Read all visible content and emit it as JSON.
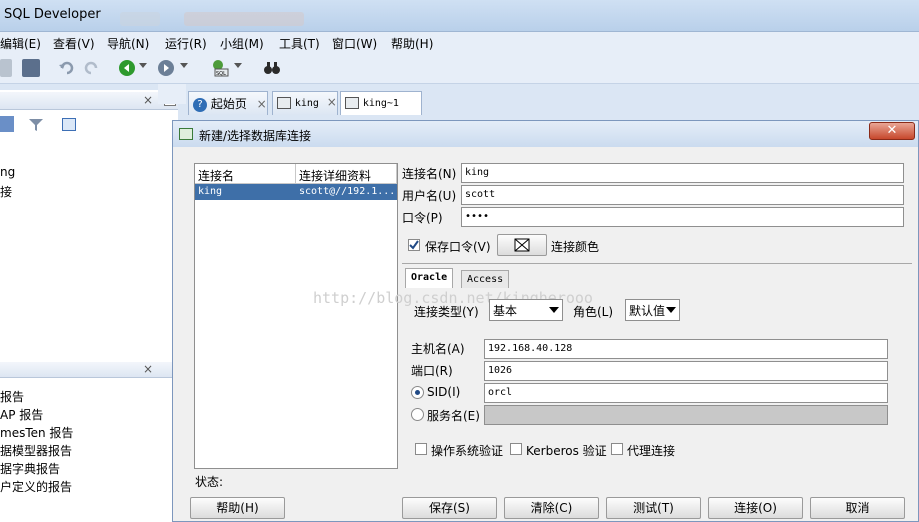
{
  "app": {
    "title": "SQL Developer"
  },
  "menu": [
    "编辑(E)",
    "查看(V)",
    "导航(N)",
    "运行(R)",
    "小组(M)",
    "工具(T)",
    "窗口(W)",
    "帮助(H)"
  ],
  "left_panel": {
    "partial_items_top": [
      "ng",
      "接"
    ],
    "reports": [
      "报告",
      "AP 报告",
      "mesTen 报告",
      "据模型器报告",
      "据字典报告",
      "户定义的报告"
    ]
  },
  "tabs": [
    {
      "label": "起始页"
    },
    {
      "label": "king"
    },
    {
      "label": "king~1"
    }
  ],
  "dialog": {
    "title": "新建/选择数据库连接",
    "list": {
      "headers": [
        "连接名",
        "连接详细资料"
      ],
      "rows": [
        {
          "name": "king",
          "detail": "scott@//192.1..."
        }
      ]
    },
    "fields": {
      "conn_name_label": "连接名(N)",
      "conn_name": "king",
      "user_label": "用户名(U)",
      "user": "scott",
      "password_label": "口令(P)",
      "password": "••••",
      "save_password_label": "保存口令(V)",
      "conn_color_label": "连接颜色"
    },
    "inner_tabs": [
      "Oracle",
      "Access"
    ],
    "watermark": "http://blog.csdn.net/kingherooo",
    "oracle": {
      "conn_type_label": "连接类型(Y)",
      "conn_type": "基本",
      "role_label": "角色(L)",
      "role": "默认值",
      "host_label": "主机名(A)",
      "host": "192.168.40.128",
      "port_label": "端口(R)",
      "port": "1026",
      "sid_label": "SID(I)",
      "sid": "orcl",
      "service_label": "服务名(E)",
      "os_auth_label": "操作系统验证",
      "kerberos_label": "Kerberos 验证",
      "proxy_label": "代理连接"
    },
    "status_label": "状态:",
    "buttons": {
      "help": "帮助(H)",
      "save": "保存(S)",
      "clear": "清除(C)",
      "test": "测试(T)",
      "connect": "连接(O)",
      "cancel": "取消"
    }
  }
}
